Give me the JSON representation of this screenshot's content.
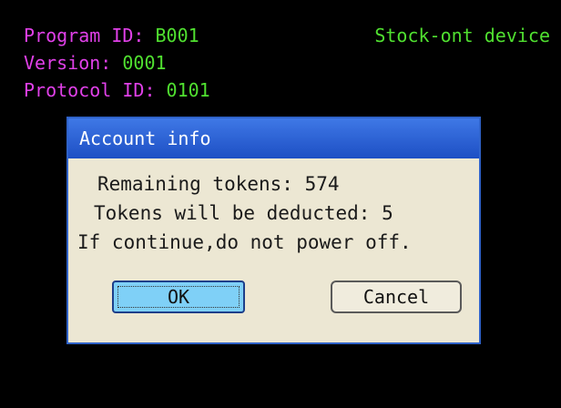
{
  "header": {
    "program_id_label": "Program ID:",
    "program_id_value": "B001",
    "version_label": "Version:",
    "version_value": "0001",
    "protocol_id_label": "Protocol ID:",
    "protocol_id_value": "0101",
    "device_name": "Stock-ont device"
  },
  "dialog": {
    "title": "Account info",
    "lines": [
      "Remaining tokens: 574",
      "Tokens will be deducted: 5",
      "If continue,do not power off."
    ],
    "ok_label": "OK",
    "cancel_label": "Cancel"
  },
  "colors": {
    "background": "#000000",
    "label_magenta": "#e040e8",
    "value_green": "#50e030",
    "title_bar_blue": "#2a5fd6",
    "dialog_body": "#ece7d3",
    "ok_button": "#7fd0f7"
  }
}
